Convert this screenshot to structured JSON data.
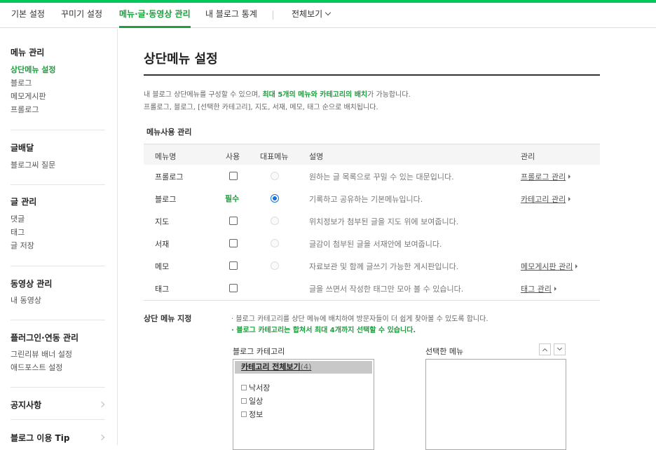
{
  "topnav": {
    "tabs": [
      "기본 설정",
      "꾸미기 설정",
      "메뉴·글·동영상 관리",
      "내 블로그 통계"
    ],
    "all_view": "전체보기"
  },
  "sidebar": {
    "menu_mgmt": {
      "title": "메뉴 관리",
      "items": [
        "상단메뉴 설정",
        "블로그",
        "메모게시판",
        "프롤로그"
      ]
    },
    "post_dist": {
      "title": "글배달",
      "items": [
        "블로그씨 질문"
      ]
    },
    "post_mgmt": {
      "title": "글 관리",
      "items": [
        "댓글",
        "태그",
        "글 저장"
      ]
    },
    "video_mgmt": {
      "title": "동영상 관리",
      "items": [
        "내 동영상"
      ]
    },
    "plugin": {
      "title": "플러그인·연동 관리",
      "items": [
        "그린리뷰 배너 설정",
        "애드포스트 설정"
      ]
    },
    "notice": "공지사항",
    "tips": "블로그 이용 Tip"
  },
  "main": {
    "title": "상단메뉴 설정",
    "desc1_pre": "내 블로그 상단메뉴를 구성할 수 있으며, ",
    "desc1_hl": "최대 5개의 메뉴와 카테고리의 배치",
    "desc1_post": "가 가능합니다.",
    "desc2": "프롤로그, 블로그, [선택한 카테고리], 지도, 서재, 메모, 태그 순으로 배치됩니다.",
    "subheading": "메뉴사용 관리",
    "table": {
      "headers": [
        "메뉴명",
        "사용",
        "대표메뉴",
        "설명",
        "관리"
      ],
      "rows": [
        {
          "name": "프롤로그",
          "use": "checkbox",
          "desc": "원하는 글 목록으로 꾸밀 수 있는 대문입니다.",
          "manage": "프롤로그 관리"
        },
        {
          "name": "블로그",
          "use": "필수",
          "desc": "기록하고 공유하는 기본메뉴입니다.",
          "manage": "카테고리 관리"
        },
        {
          "name": "지도",
          "use": "checkbox",
          "desc": "위치정보가 첨부된 글을 지도 위에 보여줍니다.",
          "manage": ""
        },
        {
          "name": "서재",
          "use": "checkbox",
          "desc": "글감이 첨부된 글을 서재안에 보여줍니다.",
          "manage": ""
        },
        {
          "name": "메모",
          "use": "checkbox",
          "desc": "자료보관 및 함께 글쓰기 가능한 게시판입니다.",
          "manage": "메모게시판 관리"
        },
        {
          "name": "태그",
          "use": "checkbox",
          "desc": "글을 쓰면서 작성한 태그만 모아 볼 수 있습니다.",
          "manage": "태그 관리"
        }
      ]
    },
    "assign": {
      "heading": "상단 메뉴 지정",
      "note1": "· 블로그 카테고리를 상단 메뉴에 배치하여 방문자들이 더 쉽게 찾아볼 수 있도록 합니다.",
      "note2": "· 블로그 카테고리는 합쳐서 최대 4개까지 선택할 수 있습니다.",
      "category_label": "블로그 카테고리",
      "selected_label": "선택한 메뉴",
      "all_categories": "카테고리 전체보기",
      "all_count": "(4)",
      "categories": [
        "낙서장",
        "일상",
        "정보"
      ]
    }
  },
  "colors": {
    "accent": "#1e9e3e",
    "topbar": "#03c75a",
    "radio_selected": "#1a6fd8"
  }
}
